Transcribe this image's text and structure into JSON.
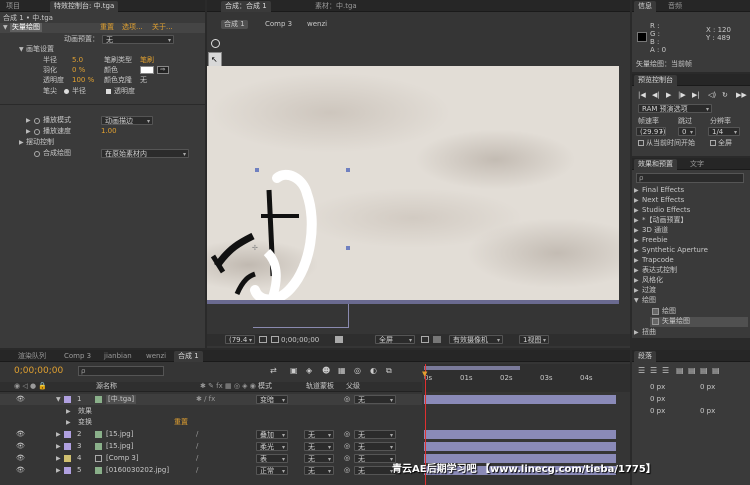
{
  "project_panel": {
    "tab_project": "项目",
    "tab_effect_controls": "特效控制台: 中.tga",
    "breadcrumb": "合成 1 • 中.tga",
    "effect_name": "矢量绘图",
    "effect_reset": "重置",
    "effect_options": "选项...",
    "effect_about": "关于...",
    "playback_mode_label": "动画预置：",
    "playback_mode_value": "无",
    "brush_settings": "画笔设置",
    "radius_label": "半径",
    "radius_value": "5.0",
    "brush_type_label": "笔刷类型",
    "brush_type_value": "笔刷",
    "feather_label": "羽化",
    "feather_value": "0 %",
    "color_label": "颜色",
    "opacity_label": "透明度",
    "opacity_value": "100 %",
    "shine_label": "颜色克隆",
    "shine_value": "无",
    "tip_label": "笔尖",
    "tip_radius": "半径",
    "tip_opacity": "透明度",
    "playback_label": "播放模式",
    "playback_value": "动画描边",
    "playback_speed_label": "播放速度",
    "playback_speed_value": "1.00",
    "motion_control": "摆动控制",
    "composite_label": "合成绘图",
    "composite_value": "在原始素材内"
  },
  "comp_panel": {
    "tab_comp": "合成：合成 1",
    "tab_footage": "素材：中.tga",
    "crumb_comp1": "合成 1",
    "crumb_comp3": "Comp 3",
    "crumb_wenzi": "wenzi",
    "zoom_value": "(79.4",
    "timecode": "0;00;00;00",
    "quality": "全屏",
    "camera": "有效摄像机",
    "views": "1视图"
  },
  "info_panel": {
    "tab_info": "信息",
    "tab_audio": "音频",
    "r": "R :",
    "g": "G :",
    "b": "B :",
    "a": "A : 0",
    "x": "X : 120",
    "y": "Y : 489",
    "status": "矢量绘图：当前帧"
  },
  "preview_panel": {
    "tab": "预览控制台",
    "ram": "RAM 预演选项",
    "fps_label": "帧速率",
    "skip_label": "跳过",
    "res_label": "分辨率",
    "fps_value": "(29.97)",
    "skip_value": "0",
    "res_value": "1/4",
    "from_current": "从当前时间开始",
    "fullscreen": "全屏"
  },
  "effects_panel": {
    "tab_effects": "效果和预置",
    "tab_text": "文字",
    "search_placeholder": "ρ",
    "items": [
      "Final Effects",
      "Next Effects",
      "Studio Effects",
      "*【动画预置】",
      "3D 通道",
      "Freebie",
      "Synthetic Aperture",
      "Trapcode",
      "表达式控制",
      "风格化",
      "过渡",
      "绘图",
      "绘图",
      "矢量绘图",
      "扭曲"
    ]
  },
  "timeline_panel": {
    "tabs": [
      "渲染队列",
      "Comp 3",
      "jianbian",
      "wenzi",
      "合成 1"
    ],
    "timecode": "0;00;00;00",
    "search_placeholder": "ρ",
    "col_name": "源名称",
    "col_mode": "模式",
    "col_trkmat": "轨道蒙板",
    "col_parent": "父级",
    "ruler": [
      "0s",
      "01s",
      "02s",
      "03s",
      "04s"
    ],
    "layers": [
      {
        "num": "1",
        "name": "[中.tga]",
        "mode": "变暗",
        "trk": "",
        "parent": "无"
      },
      {
        "num": "2",
        "name": "[15.jpg]",
        "mode": "叠加",
        "trk": "无",
        "parent": "无"
      },
      {
        "num": "3",
        "name": "[15.jpg]",
        "mode": "柔光",
        "trk": "无",
        "parent": "无"
      },
      {
        "num": "4",
        "name": "[Comp 3]",
        "mode": "表",
        "trk": "无",
        "parent": "无"
      },
      {
        "num": "5",
        "name": "[0160030202.jpg]",
        "mode": "正常",
        "trk": "无",
        "parent": "无"
      }
    ],
    "sub_effects": "效果",
    "sub_transform": "变换",
    "sub_reset": "重置"
  },
  "align_panel": {
    "tab": "段落",
    "px1": "0 px",
    "px2": "0 px",
    "px3": "0 px",
    "px4": "0 px",
    "px5": "0 px"
  },
  "watermark": "青云AE后期学习吧 【www.linecg.com/tieba/1775】"
}
